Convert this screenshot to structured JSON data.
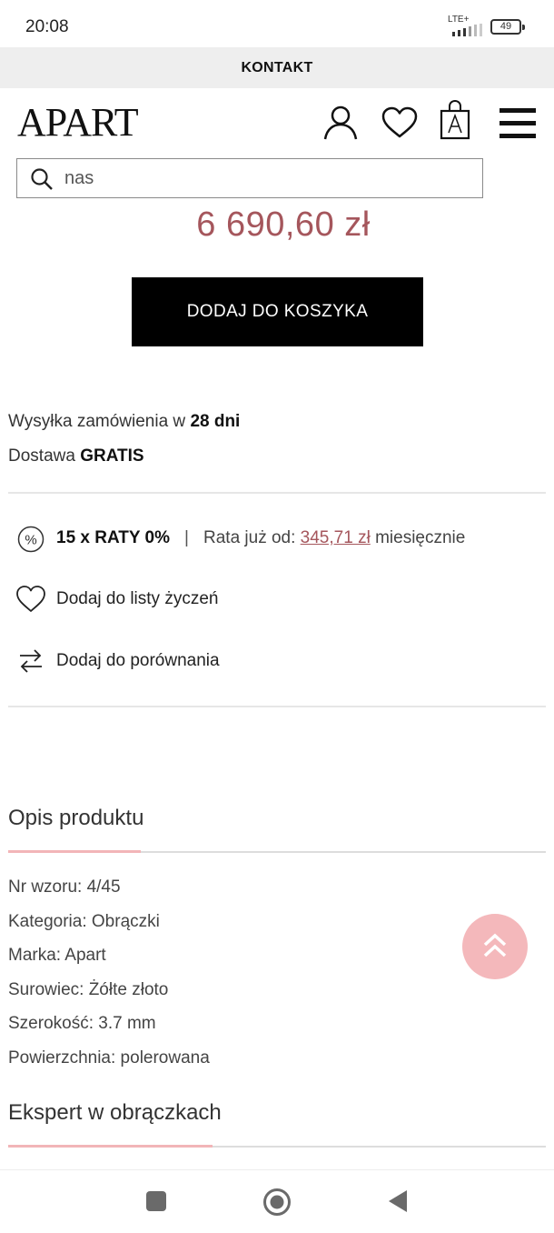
{
  "status": {
    "time": "20:08",
    "network": "LTE+",
    "battery": "49"
  },
  "contact": {
    "label": "KONTAKT"
  },
  "header": {
    "logo": "APART"
  },
  "search": {
    "value": "nas"
  },
  "product": {
    "price": "6 690,60 zł",
    "add_to_cart": "DODAJ DO KOSZYKA"
  },
  "shipping": {
    "line1_prefix": "Wysyłka zamówienia w ",
    "line1_bold": "28 dni",
    "line2_prefix": "Dostawa ",
    "line2_bold": "GRATIS"
  },
  "installments": {
    "title": "15 x RATY 0%",
    "separator": "|",
    "prefix": "Rata już od: ",
    "amount": "345,71 zł",
    "suffix": " miesięcznie"
  },
  "actions": {
    "wishlist": "Dodaj do listy życzeń",
    "compare": "Dodaj do porównania"
  },
  "description": {
    "title": "Opis produktu",
    "specs": [
      "Nr wzoru: 4/45",
      "Kategoria: Obrączki",
      "Marka: Apart",
      "Surowiec: Żółte złoto",
      "Szerokość: 3.7 mm",
      "Powierzchnia: polerowana"
    ]
  },
  "expert": {
    "title": "Ekspert w obrączkach"
  },
  "colors": {
    "price": "#a5565c",
    "accent_pink": "#f4b8bb",
    "button": "#000000"
  }
}
